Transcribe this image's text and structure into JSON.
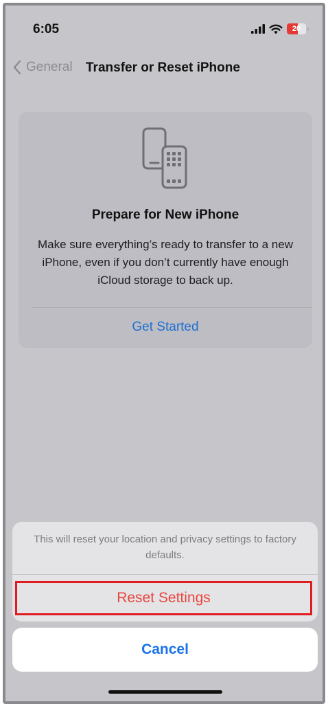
{
  "status_bar": {
    "time": "6:05",
    "battery_level": "20",
    "icons": [
      "signal-icon",
      "wifi-icon",
      "battery-icon"
    ]
  },
  "navbar": {
    "back_label": "General",
    "title": "Transfer or Reset iPhone"
  },
  "card": {
    "icon": "phone-transfer-icon",
    "title": "Prepare for New iPhone",
    "description": "Make sure everything’s ready to transfer to a new iPhone, even if you don’t currently have enough iCloud storage to back up.",
    "action_label": "Get Started"
  },
  "action_sheet": {
    "message": "This will reset your location and privacy settings to factory defaults.",
    "destructive_label": "Reset Settings",
    "cancel_label": "Cancel"
  },
  "colors": {
    "accent": "#1a73e8",
    "destructive": "#e8453c",
    "highlight_border": "#e01c22",
    "battery": "#e53935"
  }
}
